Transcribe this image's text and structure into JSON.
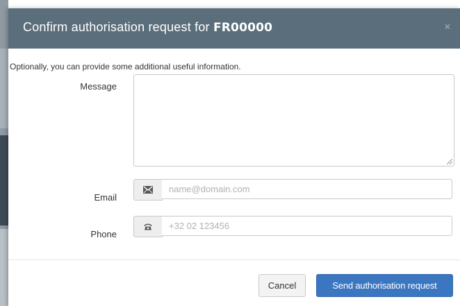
{
  "dialog": {
    "title_prefix": "Confirm authorisation request for ",
    "title_code": "FR00000",
    "close_label": "×",
    "intro": "Optionally, you can provide some additional useful information."
  },
  "form": {
    "message_label": "Message",
    "message_value": "",
    "email_label": "Email",
    "email_placeholder": "name@domain.com",
    "email_icon": "envelope-icon",
    "phone_label": "Phone",
    "phone_placeholder": "+32 02 123456",
    "phone_icon": "phone-icon"
  },
  "footer": {
    "cancel_label": "Cancel",
    "send_label": "Send authorisation request"
  },
  "colors": {
    "header_bg": "#5b6e7c",
    "primary_button": "#3b76c0"
  }
}
